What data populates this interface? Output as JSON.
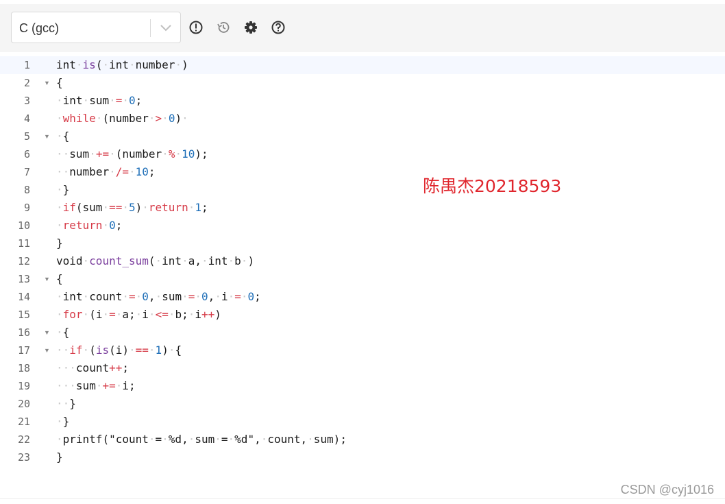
{
  "toolbar": {
    "language": "C (gcc)",
    "icons": [
      "exclamation-icon",
      "history-icon",
      "gear-icon",
      "help-icon"
    ]
  },
  "editor": {
    "active_line": 1,
    "lines": [
      {
        "n": "1",
        "fold": false,
        "code": "int·is(·int·number·)"
      },
      {
        "n": "2",
        "fold": true,
        "code": "{"
      },
      {
        "n": "3",
        "fold": false,
        "code": "·int·sum·=·0;"
      },
      {
        "n": "4",
        "fold": false,
        "code": "·while·(number·>·0)·"
      },
      {
        "n": "5",
        "fold": true,
        "code": "·{"
      },
      {
        "n": "6",
        "fold": false,
        "code": "··sum·+=·(number·%·10);"
      },
      {
        "n": "7",
        "fold": false,
        "code": "··number·/=·10;"
      },
      {
        "n": "8",
        "fold": false,
        "code": "·}"
      },
      {
        "n": "9",
        "fold": false,
        "code": "·if(sum·==·5)·return·1;"
      },
      {
        "n": "10",
        "fold": false,
        "code": "·return·0;"
      },
      {
        "n": "11",
        "fold": false,
        "code": "}"
      },
      {
        "n": "12",
        "fold": false,
        "code": "void·count_sum(·int·a,·int·b·)"
      },
      {
        "n": "13",
        "fold": true,
        "code": "{"
      },
      {
        "n": "14",
        "fold": false,
        "code": "·int·count·=·0,·sum·=·0,·i·=·0;"
      },
      {
        "n": "15",
        "fold": false,
        "code": "·for·(i·=·a;·i·<=·b;·i++)"
      },
      {
        "n": "16",
        "fold": true,
        "code": "·{"
      },
      {
        "n": "17",
        "fold": true,
        "code": "··if·(is(i)·==·1)·{"
      },
      {
        "n": "18",
        "fold": false,
        "code": "···count++;"
      },
      {
        "n": "19",
        "fold": false,
        "code": "···sum·+=·i;"
      },
      {
        "n": "20",
        "fold": false,
        "code": "··}"
      },
      {
        "n": "21",
        "fold": false,
        "code": "·}"
      },
      {
        "n": "22",
        "fold": false,
        "code": "·printf(\"count·=·%d,·sum·=·%d\",·count,·sum);"
      },
      {
        "n": "23",
        "fold": false,
        "code": "}"
      }
    ]
  },
  "annotation": "陈禺杰20218593",
  "footer_watermark": "CSDN @cyj1016",
  "colors": {
    "keyword": "#d63a47",
    "function": "#7a3e9d",
    "number": "#1f6fb8",
    "whitespace_dot": "#c8c8c8",
    "annotation": "#e0252c"
  }
}
